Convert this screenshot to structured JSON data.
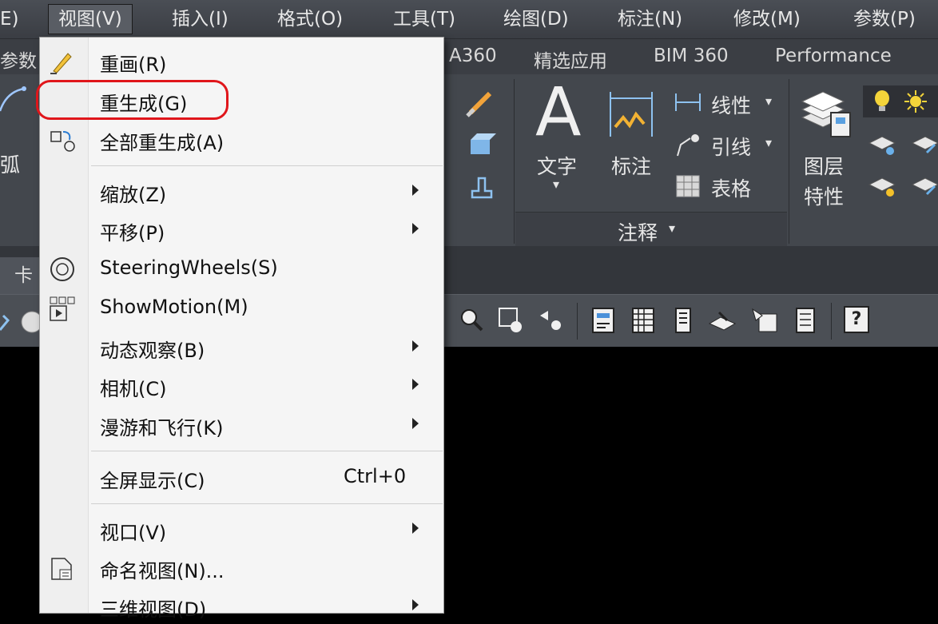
{
  "menubar": {
    "items": [
      "E)",
      "视图(V)",
      "插入(I)",
      "格式(O)",
      "工具(T)",
      "绘图(D)",
      "标注(N)",
      "修改(M)",
      "参数(P)"
    ]
  },
  "ribbon_tabs": [
    "参数",
    "A360",
    "精选应用",
    "BIM 360",
    "Performance"
  ],
  "ribbon": {
    "arc_label": "弧",
    "text_label": "文字",
    "text_glyph": "A",
    "dim_label": "标注",
    "linear_label": "线性",
    "leader_label": "引线",
    "table_label": "表格",
    "layer_label_1": "图层",
    "layer_label_2": "特性",
    "annotation_panel": "注释",
    "dropdown_arrow": "▾"
  },
  "file_tab": "卡",
  "view_menu": {
    "items": [
      {
        "label": "重画(R)",
        "icon": "pencil-icon",
        "submenu": false
      },
      {
        "label": "重生成(G)",
        "submenu": false
      },
      {
        "label": "全部重生成(A)",
        "icon": "regen-all-icon",
        "submenu": false
      },
      {
        "label": "缩放(Z)",
        "submenu": true
      },
      {
        "label": "平移(P)",
        "submenu": true
      },
      {
        "label": "SteeringWheels(S)",
        "icon": "steering-wheel-icon",
        "submenu": false
      },
      {
        "label": "ShowMotion(M)",
        "icon": "showmotion-icon",
        "submenu": false
      },
      {
        "label": "动态观察(B)",
        "submenu": true
      },
      {
        "label": "相机(C)",
        "submenu": true
      },
      {
        "label": "漫游和飞行(K)",
        "submenu": true
      },
      {
        "label": "全屏显示(C)",
        "shortcut": "Ctrl+0",
        "submenu": false
      },
      {
        "label": "视口(V)",
        "submenu": true
      },
      {
        "label": "命名视图(N)...",
        "icon": "named-view-icon",
        "submenu": false
      },
      {
        "label": "三维视图(D)",
        "submenu": true
      }
    ]
  },
  "colors": {
    "highlight": "#e0161b",
    "menubar_bg": "#3f4248",
    "menu_bg": "#f5f5f5"
  },
  "toolbar": {
    "help_label": "?"
  }
}
